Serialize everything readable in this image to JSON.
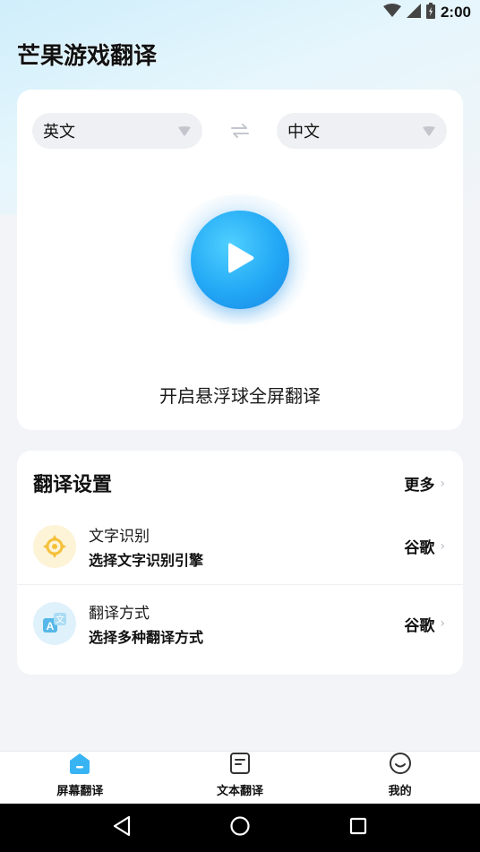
{
  "status_bar": {
    "time": "2:00"
  },
  "app": {
    "title": "芒果游戏翻译"
  },
  "languages": {
    "source": "英文",
    "target": "中文"
  },
  "main": {
    "start_label": "开启悬浮球全屏翻译"
  },
  "settings": {
    "title": "翻译设置",
    "more_label": "更多",
    "rows": [
      {
        "title": "文字识别",
        "subtitle": "选择文字识别引擎",
        "value": "谷歌",
        "icon": "ocr-target-icon"
      },
      {
        "title": "翻译方式",
        "subtitle": "选择多种翻译方式",
        "value": "谷歌",
        "icon": "translate-icon"
      }
    ]
  },
  "tabs": [
    {
      "label": "屏幕翻译",
      "icon": "home-icon",
      "active": true
    },
    {
      "label": "文本翻译",
      "icon": "document-icon",
      "active": false
    },
    {
      "label": "我的",
      "icon": "smile-icon",
      "active": false
    }
  ],
  "colors": {
    "accent": "#22a8f5",
    "accent_dark": "#1a85e6",
    "ocr_icon": "#f5c03a",
    "translate_icon": "#56b8e8"
  }
}
